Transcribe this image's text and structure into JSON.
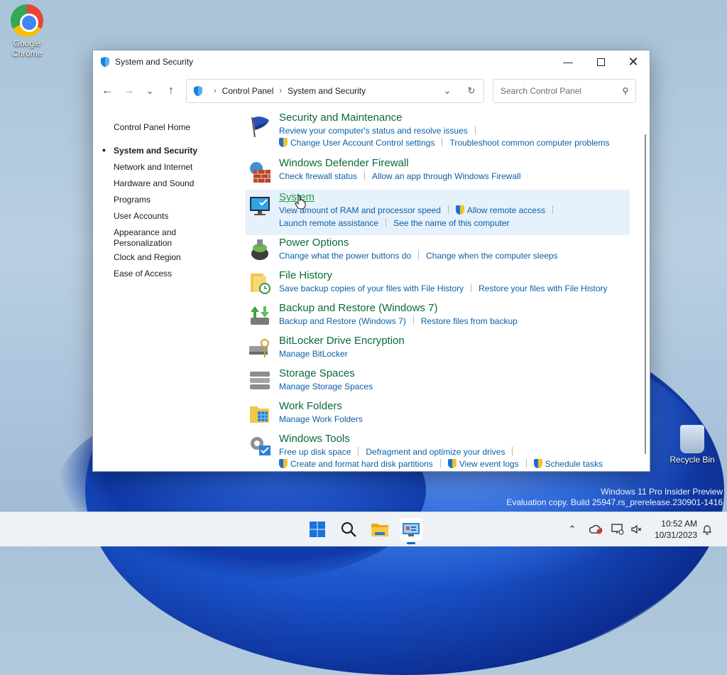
{
  "desktop": {
    "icons": [
      {
        "label": "Google Chrome",
        "icon": "chrome-icon"
      },
      {
        "label": "Recycle Bin",
        "icon": "recycle-bin-icon"
      }
    ],
    "watermark": {
      "line1": "Windows 11 Pro Insider Preview",
      "line2": "Evaluation copy. Build 25947.rs_prerelease.230901-1416"
    }
  },
  "window": {
    "title": "System and Security",
    "address": {
      "crumbs": [
        "Control Panel",
        "System and Security"
      ]
    },
    "search": {
      "placeholder": "Search Control Panel"
    },
    "sidebar": {
      "items": [
        {
          "label": "Control Panel Home"
        },
        {
          "label": "System and Security",
          "current": true
        },
        {
          "label": "Network and Internet"
        },
        {
          "label": "Hardware and Sound"
        },
        {
          "label": "Programs"
        },
        {
          "label": "User Accounts"
        },
        {
          "label": "Appearance and",
          "label2": "Personalization"
        },
        {
          "label": "Clock and Region"
        },
        {
          "label": "Ease of Access"
        }
      ]
    },
    "categories": [
      {
        "title": "Security and Maintenance",
        "icon": "flag-icon",
        "links": [
          "Review your computer's status and resolve issues",
          "Change User Account Control settings",
          "Troubleshoot common computer problems"
        ]
      },
      {
        "title": "Windows Defender Firewall",
        "icon": "firewall-icon",
        "links": [
          "Check firewall status",
          "Allow an app through Windows Firewall"
        ]
      },
      {
        "title": "System",
        "icon": "monitor-icon",
        "links": [
          "View amount of RAM and processor speed",
          "Allow remote access",
          "Launch remote assistance",
          "See the name of this computer"
        ]
      },
      {
        "title": "Power Options",
        "icon": "battery-icon",
        "links": [
          "Change what the power buttons do",
          "Change when the computer sleeps"
        ]
      },
      {
        "title": "File History",
        "icon": "file-history-icon",
        "links": [
          "Save backup copies of your files with File History",
          "Restore your files with File History"
        ]
      },
      {
        "title": "Backup and Restore (Windows 7)",
        "icon": "backup-icon",
        "links": [
          "Backup and Restore (Windows 7)",
          "Restore files from backup"
        ]
      },
      {
        "title": "BitLocker Drive Encryption",
        "icon": "bitlocker-icon",
        "links": [
          "Manage BitLocker"
        ]
      },
      {
        "title": "Storage Spaces",
        "icon": "storage-icon",
        "links": [
          "Manage Storage Spaces"
        ]
      },
      {
        "title": "Work Folders",
        "icon": "work-folders-icon",
        "links": [
          "Manage Work Folders"
        ]
      },
      {
        "title": "Windows Tools",
        "icon": "tools-icon",
        "links": [
          "Free up disk space",
          "Defragment and optimize your drives",
          "Create and format hard disk partitions",
          "View event logs",
          "Schedule tasks"
        ]
      }
    ]
  },
  "taskbar": {
    "clock": {
      "time": "10:52 AM",
      "date": "10/31/2023"
    }
  }
}
